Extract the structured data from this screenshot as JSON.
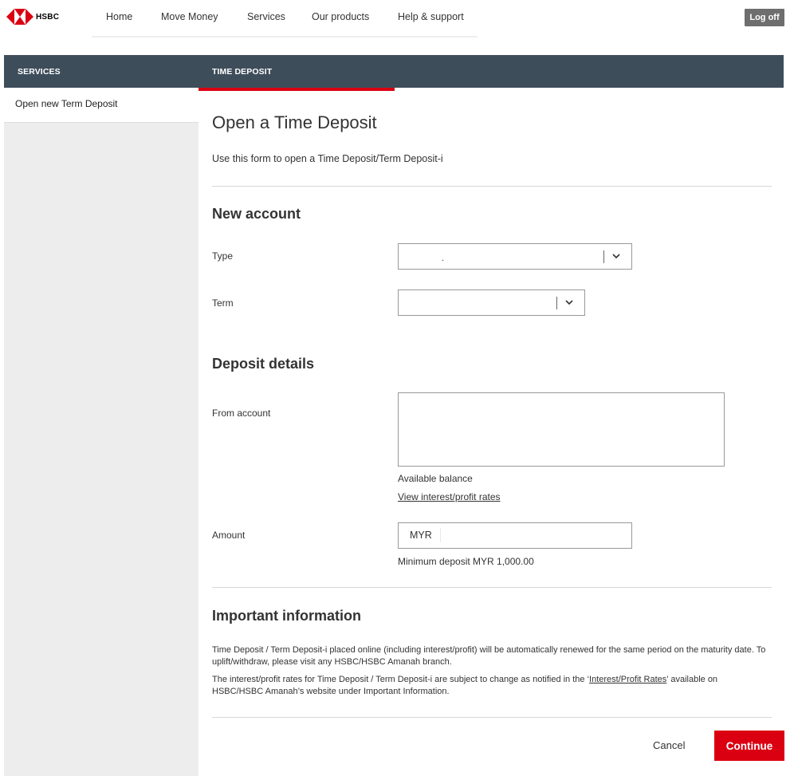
{
  "brand": {
    "name": "HSBC",
    "accent": "#db0011",
    "header_bg": "#3e4d5a"
  },
  "nav": {
    "items": [
      {
        "label": "Home"
      },
      {
        "label": "Move Money"
      },
      {
        "label": "Services"
      },
      {
        "label": "Our products"
      },
      {
        "label": "Help & support"
      }
    ],
    "logoff_label": "Log off"
  },
  "sidebar": {
    "header": "SERVICES",
    "items": [
      {
        "label": "Open new Term Deposit"
      }
    ]
  },
  "main": {
    "tab_label": "TIME DEPOSIT",
    "title": "Open a Time Deposit",
    "subtitle": "Use this form to open a Time Deposit/Term Deposit-i",
    "new_account": {
      "heading": "New account",
      "type_label": "Type",
      "type_value": ".",
      "term_label": "Term",
      "term_value": ""
    },
    "deposit_details": {
      "heading": "Deposit details",
      "from_account_label": "From account",
      "available_balance_label": "Available balance",
      "rates_link": "View interest/profit rates",
      "amount_label": "Amount",
      "amount_currency": "MYR",
      "amount_value": "",
      "minimum_note": "Minimum deposit MYR 1,000.00"
    },
    "important": {
      "heading": "Important information",
      "para1": "Time Deposit / Term Deposit-i placed online (including interest/profit) will be automatically renewed for the same period on the maturity date. To uplift/withdraw, please visit any HSBC/HSBC Amanah branch.",
      "para2_prefix": "The interest/profit rates for Time Deposit / Term Deposit-i are subject to change as notified in the ‘",
      "para2_link": "Interest/Profit Rates",
      "para2_suffix": "’ available on HSBC/HSBC Amanah’s website under Important Information."
    },
    "actions": {
      "cancel_label": "Cancel",
      "continue_label": "Continue"
    }
  }
}
